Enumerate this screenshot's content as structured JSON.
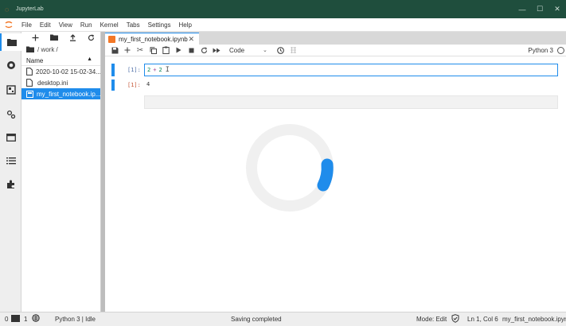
{
  "window": {
    "title": "JupyterLab"
  },
  "menu": [
    "File",
    "Edit",
    "View",
    "Run",
    "Kernel",
    "Tabs",
    "Settings",
    "Help"
  ],
  "filebrowser": {
    "path": "/ work /",
    "header": "Name",
    "items": [
      {
        "name": "2020-10-02 15-02-34...",
        "type": "file",
        "selected": false
      },
      {
        "name": "desktop.ini",
        "type": "file",
        "selected": false
      },
      {
        "name": "my_first_notebook.ip...",
        "type": "notebook",
        "selected": true
      }
    ]
  },
  "tab": {
    "label": "my_first_notebook.ipynb"
  },
  "toolbar": {
    "cell_type": "Code",
    "kernel": "Python 3"
  },
  "cells": [
    {
      "in_prompt": "[1]:",
      "source_a": "2",
      "source_op": "+",
      "source_b": "2",
      "out_prompt": "[1]:",
      "output": "4"
    }
  ],
  "statusbar": {
    "count_a": "0",
    "count_b": "1",
    "kernel": "Python 3 | Idle",
    "message": "Saving completed",
    "mode": "Mode: Edit",
    "position": "Ln 1, Col 6",
    "filename": "my_first_notebook.ipynb"
  },
  "colors": {
    "accent": "#1f8ceb",
    "titlebar": "#1f4e3d",
    "notebook_icon": "#f37726"
  }
}
